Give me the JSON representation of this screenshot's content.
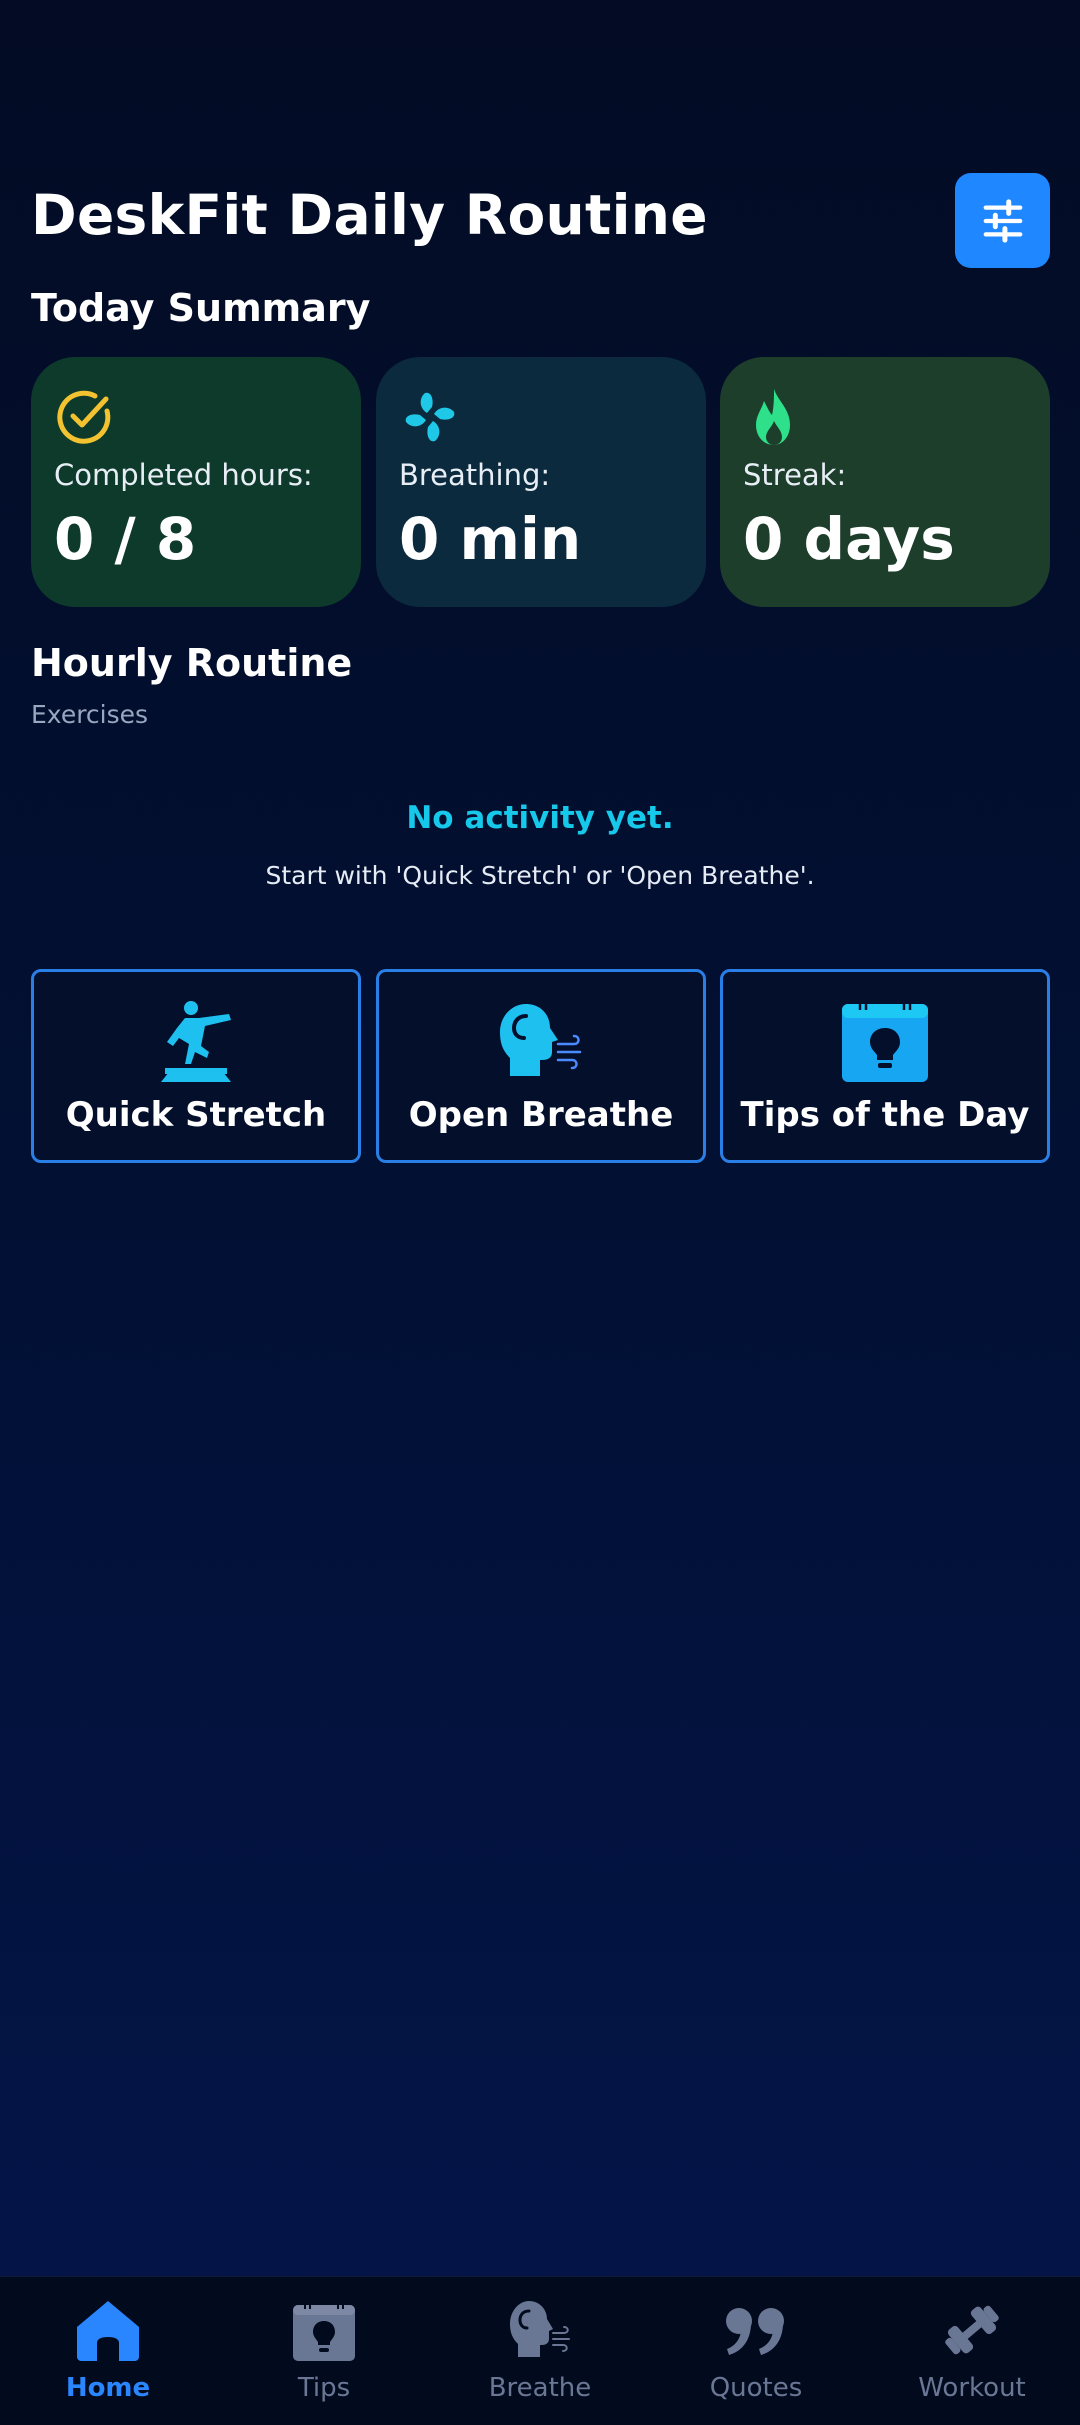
{
  "header": {
    "title": "DeskFit Daily Routine"
  },
  "summary": {
    "title": "Today Summary",
    "cards": [
      {
        "label": "Completed hours:",
        "value": "0 / 8",
        "icon": "check-circle-icon"
      },
      {
        "label": "Breathing:",
        "value": "0 min",
        "icon": "fan-icon"
      },
      {
        "label": "Streak:",
        "value": "0 days",
        "icon": "flame-icon"
      }
    ]
  },
  "routine": {
    "title": "Hourly Routine",
    "subtitle": "Exercises",
    "empty_title": "No activity yet.",
    "empty_description": "Start with 'Quick Stretch' or 'Open Breathe'."
  },
  "actions": [
    {
      "label": "Quick Stretch",
      "icon": "stretch-icon"
    },
    {
      "label": "Open Breathe",
      "icon": "breathe-head-icon"
    },
    {
      "label": "Tips of the Day",
      "icon": "calendar-lightbulb-icon"
    }
  ],
  "nav": [
    {
      "label": "Home",
      "icon": "home-icon",
      "active": true
    },
    {
      "label": "Tips",
      "icon": "calendar-lightbulb-icon",
      "active": false
    },
    {
      "label": "Breathe",
      "icon": "breathe-head-icon",
      "active": false
    },
    {
      "label": "Quotes",
      "icon": "quote-icon",
      "active": false
    },
    {
      "label": "Workout",
      "icon": "dumbbell-icon",
      "active": false
    }
  ],
  "colors": {
    "accent": "#1f87ff",
    "nav_active": "#2a86ff",
    "nav_inactive": "#6a7794",
    "empty_title": "#16c8e9",
    "check_icon": "#f2c230",
    "flame_icon": "#2fe08a",
    "fan_icon": "#1ec8e6"
  }
}
